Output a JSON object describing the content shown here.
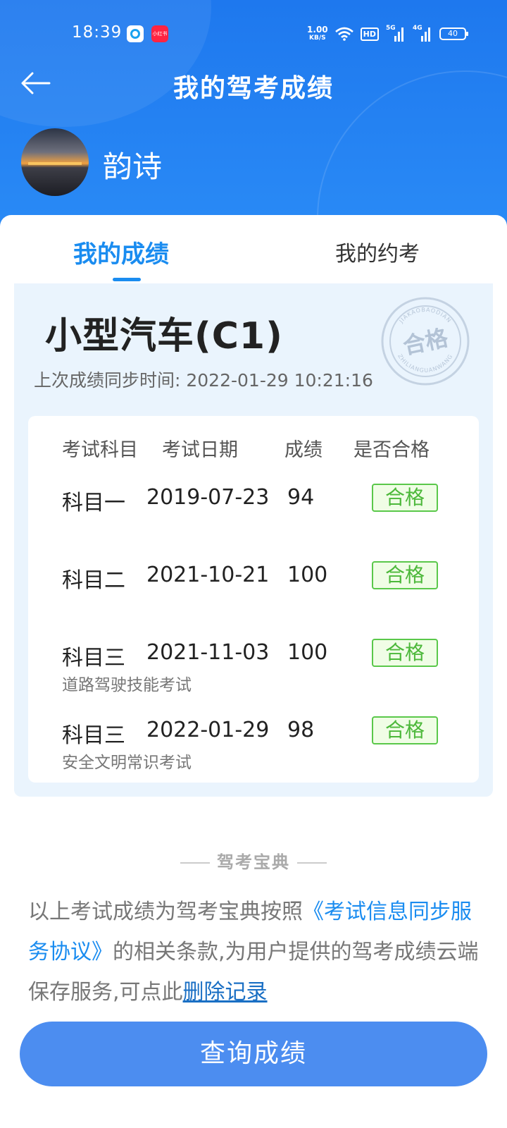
{
  "status_bar": {
    "time": "18:39",
    "net_speed_value": "1.00",
    "net_speed_unit": "KB/S",
    "hd": "HD",
    "sig1": "5G",
    "sig2": "4G",
    "battery": "40",
    "app_badge": "小红书"
  },
  "header": {
    "title": "我的驾考成绩",
    "username": "韵诗"
  },
  "tabs": [
    {
      "label": "我的成绩",
      "active": true
    },
    {
      "label": "我的约考",
      "active": false
    }
  ],
  "panel": {
    "car_type": "小型汽车(C1)",
    "sync_text": "上次成绩同步时间: 2022-01-29 10:21:16",
    "stamp_text": "合格",
    "stamp_ring_top": "JIAKAOBAODIAN",
    "stamp_ring_bottom": "ZHILIANGUANWANG"
  },
  "table": {
    "headers": [
      "考试科目",
      "考试日期",
      "成绩",
      "是否合格"
    ],
    "rows": [
      {
        "subject": "科目一",
        "date": "2019-07-23",
        "score": "94",
        "result": "合格",
        "note": ""
      },
      {
        "subject": "科目二",
        "date": "2021-10-21",
        "score": "100",
        "result": "合格",
        "note": ""
      },
      {
        "subject": "科目三",
        "date": "2021-11-03",
        "score": "100",
        "result": "合格",
        "note": "道路驾驶技能考试"
      },
      {
        "subject": "科目三",
        "date": "2022-01-29",
        "score": "98",
        "result": "合格",
        "note": "安全文明常识考试"
      }
    ]
  },
  "footer": {
    "brand": "驾考宝典",
    "desc_pre": "以上考试成绩为驾考宝典按照",
    "desc_link": "《考试信息同步服务协议》",
    "desc_mid": "的相关条款,为用户提供的驾考成绩云端保存服务,可点此",
    "delete_link": "删除记录",
    "query_button": "查询成绩"
  },
  "colors": {
    "header_blue": "#1e78ee",
    "accent_blue": "#1a8cf0",
    "pass_green": "#4cb83a",
    "button_blue": "#4c8df0"
  }
}
